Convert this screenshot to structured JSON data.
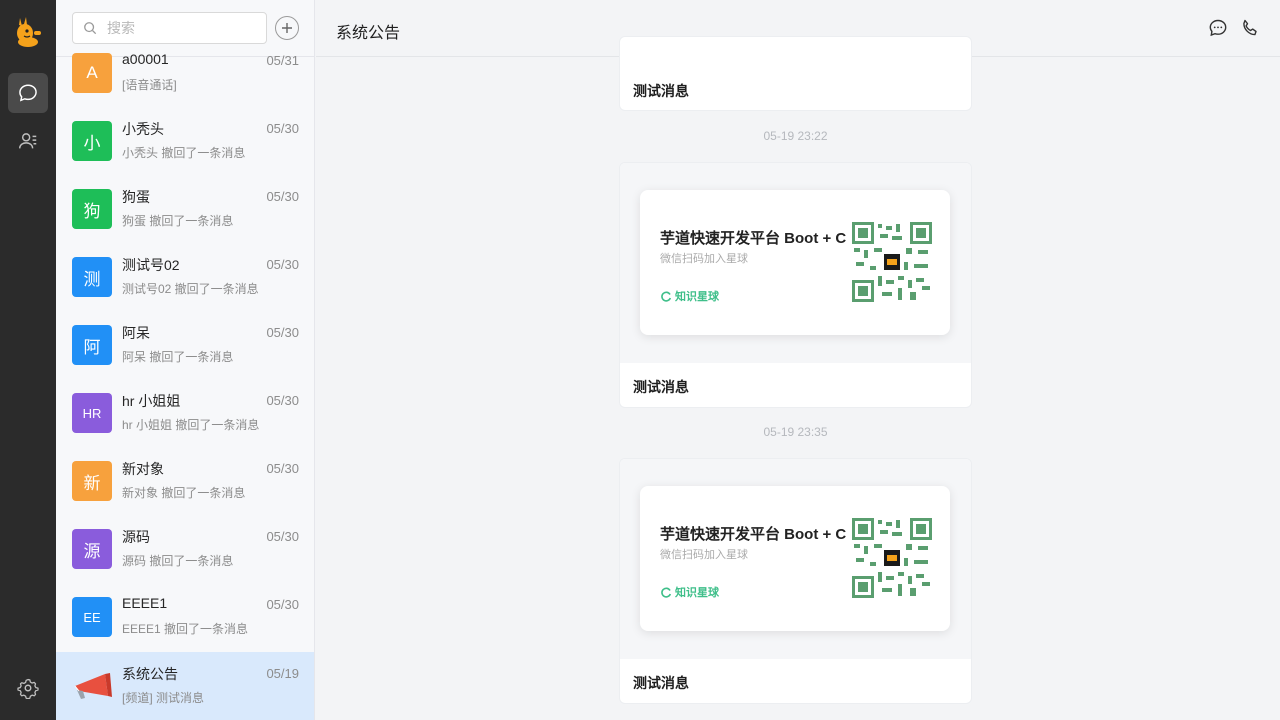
{
  "search": {
    "placeholder": "搜索"
  },
  "conversations": [
    {
      "initial": "A",
      "name": "a00001",
      "date": "05/31",
      "preview": "[语音通话]",
      "color": "#f7a13d"
    },
    {
      "initial": "小",
      "name": "小秃头",
      "date": "05/30",
      "preview": "小秃头 撤回了一条消息",
      "color": "#1ebe58"
    },
    {
      "initial": "狗",
      "name": "狗蛋",
      "date": "05/30",
      "preview": "狗蛋 撤回了一条消息",
      "color": "#1ebe58"
    },
    {
      "initial": "测",
      "name": "测试号02",
      "date": "05/30",
      "preview": "测试号02 撤回了一条消息",
      "color": "#2190f6"
    },
    {
      "initial": "阿",
      "name": "阿呆",
      "date": "05/30",
      "preview": "阿呆 撤回了一条消息",
      "color": "#2190f6"
    },
    {
      "initial": "HR",
      "name": "hr 小姐姐",
      "date": "05/30",
      "preview": "hr 小姐姐 撤回了一条消息",
      "color": "#8a5cdc"
    },
    {
      "initial": "新",
      "name": "新对象",
      "date": "05/30",
      "preview": "新对象 撤回了一条消息",
      "color": "#f7a13d"
    },
    {
      "initial": "源",
      "name": "源码",
      "date": "05/30",
      "preview": "源码 撤回了一条消息",
      "color": "#8a5cdc"
    },
    {
      "initial": "EE",
      "name": "EEEE1",
      "date": "05/30",
      "preview": "EEEE1 撤回了一条消息",
      "color": "#2190f6"
    },
    {
      "initial": "",
      "name": "系统公告",
      "date": "05/19",
      "preview": "[频道] 测试消息",
      "color": ""
    }
  ],
  "header": {
    "title": "系统公告"
  },
  "messages": {
    "first_text": "测试消息",
    "time1": "05-19 23:22",
    "card1_title": "芋道快速开发平台 Boot + C",
    "card1_sub": "微信扫码加入星球",
    "card1_brand": "知识星球",
    "card1_text": "测试消息",
    "time2": "05-19 23:35",
    "card2_title": "芋道快速开发平台 Boot + C",
    "card2_sub": "微信扫码加入星球",
    "card2_brand": "知识星球",
    "card2_text": "测试消息"
  },
  "colors": {
    "rail": "#2b2b2b",
    "active_item": "#d9e9fc",
    "brand_green": "#3fbf8a",
    "qr_green": "#5a9e6f"
  },
  "icons": {
    "logo": "mascot-logo-icon",
    "chat": "chat-bubble-icon",
    "contacts": "contacts-icon",
    "settings": "gear-icon",
    "search": "search-icon",
    "add": "plus-icon",
    "header_chat": "chat-dots-icon",
    "header_call": "phone-icon"
  }
}
